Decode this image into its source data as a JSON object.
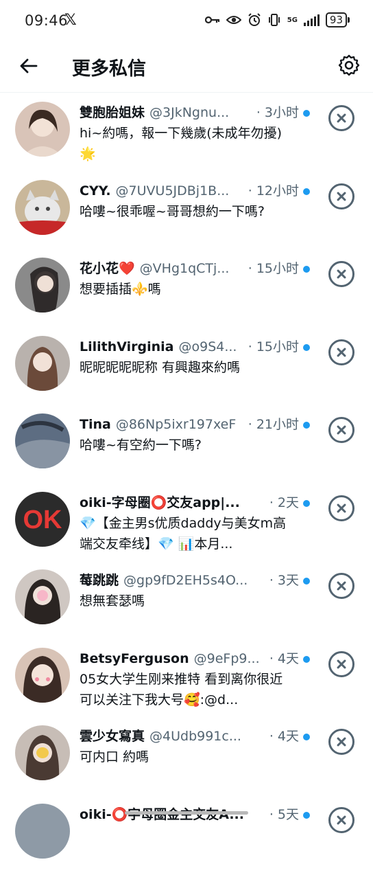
{
  "status_bar": {
    "time": "09:46",
    "x_logo": "𝕏",
    "network": "5G",
    "battery": "93"
  },
  "header": {
    "title": "更多私信"
  },
  "colors": {
    "accent_dot": "#1d9bf0",
    "secondary_text": "#536471",
    "primary_text": "#0f1419"
  },
  "messages": [
    {
      "name": "雙胞胎姐妹",
      "handle": "@3JkNgnu...",
      "time": "· 3小时",
      "text": "hi~約嗎，報一下幾歲(未成年勿擾) 🌟",
      "avatar_color": "#d9c4b8"
    },
    {
      "name": "CYY.",
      "handle": "@7UVU5JDBj1B...",
      "time": "· 12小时",
      "text": "哈嘍~很乖喔~哥哥想約一下嗎?",
      "avatar_color": "#c9b79a"
    },
    {
      "name": "花小花❤️",
      "handle": "@VHg1qCTj...",
      "time": "· 15小时",
      "text": "想要插插⚜️嗎",
      "avatar_color": "#8a8a8a"
    },
    {
      "name": "LilithVirginia",
      "handle": "@o9S4...",
      "time": "· 15小时",
      "text": "昵昵昵昵昵称 有興趣來約嗎",
      "avatar_color": "#b9b2ad"
    },
    {
      "name": "Tina",
      "handle": "@86Np5ixr197xeF",
      "time": "· 21小时",
      "text": "哈嘍~有空約一下嗎?",
      "avatar_color": "#5d6d82"
    },
    {
      "name": "oiki-字母圈⭕交友app|...",
      "handle": "",
      "time": "· 2天",
      "text": "💎【金主男s优质daddy与美女m高端交友牵线】💎 📊本月...",
      "avatar_color": "#2b2b2b",
      "avatar_logo": "OK"
    },
    {
      "name": "莓跳跳",
      "handle": "@gp9fD2EH5s4O...",
      "time": "· 3天",
      "text": "想無套瑟嗎",
      "avatar_color": "#cfc7c2"
    },
    {
      "name": "BetsyFerguson",
      "handle": "@9eFp9...",
      "time": "· 4天",
      "text": "05女大学生刚来推特 看到离你很近 可以关注下我大号🥰:@d...",
      "avatar_color": "#d8c3b6"
    },
    {
      "name": "雲少女寫真",
      "handle": "@4Udb991c...",
      "time": "· 4天",
      "text": "可内口 約嗎",
      "avatar_color": "#c7bdb6"
    },
    {
      "name": "oiki-⭕字母圈金主交友A...",
      "handle": "",
      "time": "· 5天",
      "text": "",
      "avatar_color": "#8e9aa6"
    }
  ]
}
